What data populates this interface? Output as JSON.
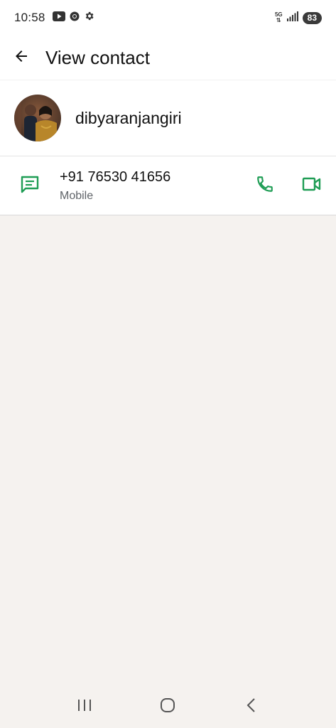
{
  "status_bar": {
    "time": "10:58",
    "network": "5G",
    "battery": "83",
    "icons_left": [
      "youtube-icon",
      "chrome-icon",
      "settings-icon"
    ],
    "icons_right": [
      "5g-icon",
      "signal-icon",
      "battery-icon"
    ]
  },
  "app_bar": {
    "title": "View contact",
    "back_icon": "arrow-back-icon"
  },
  "contact": {
    "name": "dibyaranjangiri",
    "avatar": "contact-photo"
  },
  "phone": {
    "number": "+91 76530 41656",
    "type": "Mobile",
    "message_icon": "message-icon",
    "call_icon": "phone-icon",
    "video_icon": "video-call-icon"
  },
  "nav_bar": {
    "icons": [
      "recent-apps-icon",
      "home-icon",
      "back-nav-icon"
    ]
  },
  "colors": {
    "accent_green": "#1f9d55",
    "background": "#f5f2ef",
    "surface": "#ffffff"
  }
}
